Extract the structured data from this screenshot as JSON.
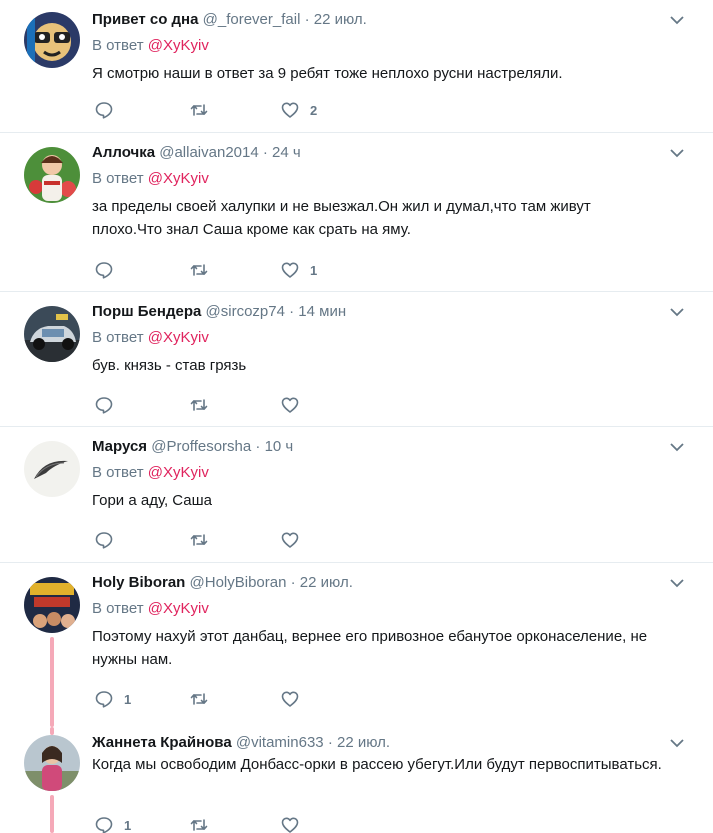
{
  "tweets": [
    {
      "name": "Привет со дна",
      "handle": "@_forever_fail",
      "dot": "·",
      "time": "22 июл.",
      "reply_prefix": "В ответ",
      "reply_to": "@XyKyiv",
      "text": "Я смотрю наши в ответ за 9 ребят тоже неплохо русни настреляли.",
      "reply_count": "",
      "retweet_count": "",
      "like_count": "2",
      "avatar_icon": "cartoon-face-avatar-icon"
    },
    {
      "name": "Аллочка",
      "handle": "@allaivan2014",
      "dot": "·",
      "time": "24 ч",
      "reply_prefix": "В ответ",
      "reply_to": "@XyKyiv",
      "text": "за пределы своей халупки и не выезжал.Он жил и думал,что там живут плохо.Что знал Саша кроме как срать на яму.",
      "reply_count": "",
      "retweet_count": "",
      "like_count": "1",
      "avatar_icon": "girl-with-flowers-avatar-icon"
    },
    {
      "name": "Порш Бендера",
      "handle": "@sircozp74",
      "dot": "·",
      "time": "14 мин",
      "reply_prefix": "В ответ",
      "reply_to": "@XyKyiv",
      "text": "був. князь - став грязь",
      "reply_count": "",
      "retweet_count": "",
      "like_count": "",
      "avatar_icon": "car-avatar-icon"
    },
    {
      "name": "Маруся",
      "handle": "@Proffesorsha",
      "dot": "·",
      "time": "10 ч",
      "reply_prefix": "В ответ",
      "reply_to": "@XyKyiv",
      "text": "Гори а аду, Саша",
      "reply_count": "",
      "retweet_count": "",
      "like_count": "",
      "avatar_icon": "boomerang-avatar-icon"
    },
    {
      "name": "Holy Biboran",
      "handle": "@HolyBiboran",
      "dot": "·",
      "time": "22 июл.",
      "reply_prefix": "В ответ",
      "reply_to": "@XyKyiv",
      "text": "Поэтому нахуй этот данбац, вернее его привозное ебанутое орконаселение, не нужны нам.",
      "reply_count": "1",
      "retweet_count": "",
      "like_count": "",
      "avatar_icon": "poster-avatar-icon"
    },
    {
      "name": "Жаннета Крайнова",
      "handle": "@vitamin633",
      "dot": "·",
      "time": "22 июл.",
      "reply_prefix": "",
      "reply_to": "",
      "text": "Когда мы освободим Донбасс-орки в рассею убегут.Или будут первоспитываться.",
      "reply_count": "1",
      "retweet_count": "",
      "like_count": "",
      "avatar_icon": "woman-portrait-avatar-icon"
    }
  ],
  "colors": {
    "mention": "#e0245e",
    "muted": "#657786",
    "thread_line": "#f5a9b8"
  }
}
